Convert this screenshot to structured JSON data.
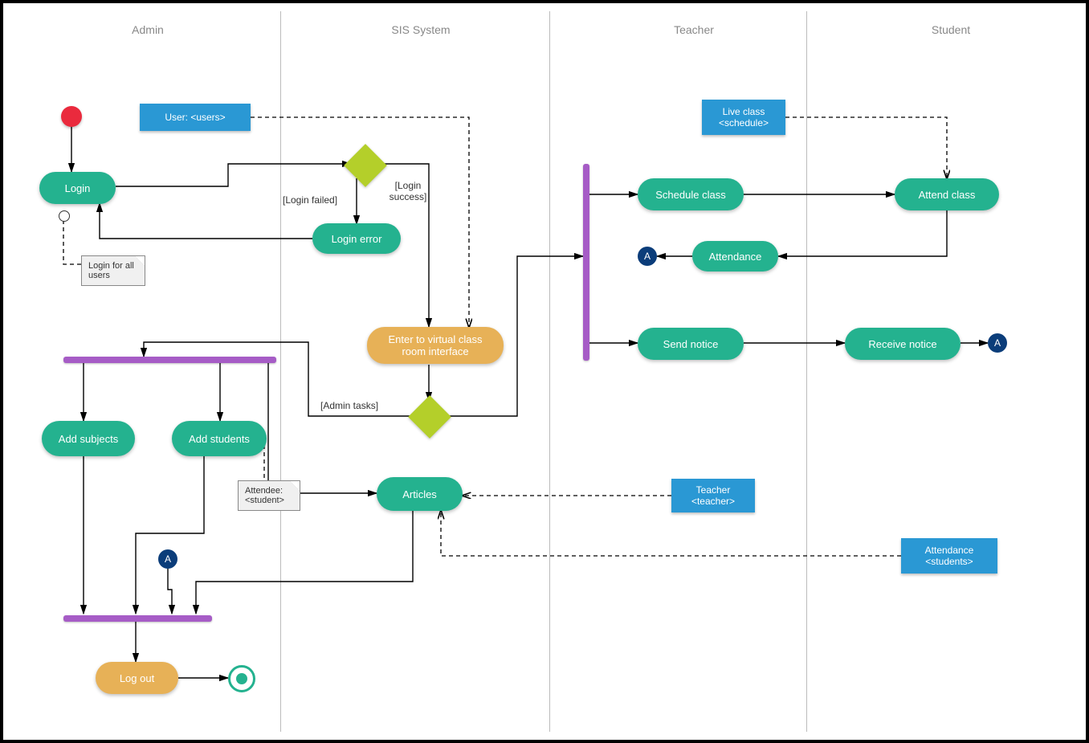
{
  "lanes": {
    "admin": "Admin",
    "sis": "SIS System",
    "teacher": "Teacher",
    "student": "Student"
  },
  "activities": {
    "login": "Login",
    "login_error": "Login error",
    "enter_vc": "Enter to virtual class room interface",
    "add_subjects": "Add subjects",
    "add_students": "Add students",
    "articles": "Articles",
    "log_out": "Log out",
    "schedule_class": "Schedule class",
    "attend_class": "Attend class",
    "attendance": "Attendance",
    "send_notice": "Send notice",
    "receive_notice": "Receive notice"
  },
  "objects": {
    "user": "User: <users>",
    "live_class": "Live class\n<schedule>",
    "teacher": "Teacher\n<teacher>",
    "attendance_students": "Attendance\n<students>"
  },
  "notes": {
    "login_all": "Login for all users",
    "attendee": "Attendee: <student>"
  },
  "guards": {
    "login_failed": "[Login failed]",
    "login_success": "[Login success]",
    "admin_tasks": "[Admin tasks]"
  },
  "connector_label": "A",
  "chart_data": {
    "type": "uml-activity-diagram",
    "swimlanes": [
      "Admin",
      "SIS System",
      "Teacher",
      "Student"
    ],
    "nodes": [
      {
        "id": "start",
        "type": "initial",
        "lane": "Admin"
      },
      {
        "id": "login",
        "type": "activity",
        "lane": "Admin",
        "label": "Login"
      },
      {
        "id": "d1",
        "type": "decision",
        "lane": "SIS System"
      },
      {
        "id": "login_error",
        "type": "activity",
        "lane": "SIS System",
        "label": "Login error"
      },
      {
        "id": "enter_vc",
        "type": "activity",
        "lane": "SIS System",
        "label": "Enter to virtual class room interface"
      },
      {
        "id": "d2",
        "type": "decision",
        "lane": "SIS System"
      },
      {
        "id": "fork_admin",
        "type": "fork",
        "lane": "Admin",
        "orientation": "horizontal"
      },
      {
        "id": "add_subjects",
        "type": "activity",
        "lane": "Admin",
        "label": "Add subjects"
      },
      {
        "id": "add_students",
        "type": "activity",
        "lane": "Admin",
        "label": "Add students"
      },
      {
        "id": "articles",
        "type": "activity",
        "lane": "SIS System",
        "label": "Articles"
      },
      {
        "id": "join_admin",
        "type": "join",
        "lane": "Admin",
        "orientation": "horizontal"
      },
      {
        "id": "log_out",
        "type": "activity",
        "lane": "Admin",
        "label": "Log out"
      },
      {
        "id": "end",
        "type": "final",
        "lane": "Admin"
      },
      {
        "id": "connA_in",
        "type": "connector",
        "label": "A",
        "lane": "Admin"
      },
      {
        "id": "fork_ts",
        "type": "fork",
        "lane": "Teacher",
        "orientation": "vertical"
      },
      {
        "id": "schedule_class",
        "type": "activity",
        "lane": "Teacher",
        "label": "Schedule class"
      },
      {
        "id": "attend_class",
        "type": "activity",
        "lane": "Student",
        "label": "Attend class"
      },
      {
        "id": "attendance",
        "type": "activity",
        "lane": "Teacher",
        "label": "Attendance"
      },
      {
        "id": "connA_out1",
        "type": "connector",
        "label": "A",
        "lane": "Teacher"
      },
      {
        "id": "send_notice",
        "type": "activity",
        "lane": "Teacher",
        "label": "Send notice"
      },
      {
        "id": "receive_notice",
        "type": "activity",
        "lane": "Student",
        "label": "Receive notice"
      },
      {
        "id": "connA_out2",
        "type": "connector",
        "label": "A",
        "lane": "Student"
      },
      {
        "id": "obj_user",
        "type": "object",
        "lane": "Admin",
        "label": "User: <users>"
      },
      {
        "id": "obj_live",
        "type": "object",
        "lane": "Teacher",
        "label": "Live class <schedule>"
      },
      {
        "id": "obj_teacher",
        "type": "object",
        "lane": "Teacher",
        "label": "Teacher <teacher>"
      },
      {
        "id": "obj_att_students",
        "type": "object",
        "lane": "Student",
        "label": "Attendance <students>"
      },
      {
        "id": "note_login",
        "type": "note",
        "lane": "Admin",
        "label": "Login for all users"
      },
      {
        "id": "note_attendee",
        "type": "note",
        "lane": "Admin",
        "label": "Attendee: <student>"
      }
    ],
    "edges": [
      {
        "from": "start",
        "to": "login"
      },
      {
        "from": "login",
        "to": "d1"
      },
      {
        "from": "d1",
        "to": "login_error",
        "guard": "[Login failed]"
      },
      {
        "from": "login_error",
        "to": "login"
      },
      {
        "from": "d1",
        "to": "enter_vc",
        "guard": "[Login success]"
      },
      {
        "from": "enter_vc",
        "to": "d2"
      },
      {
        "from": "d2",
        "to": "fork_admin",
        "guard": "[Admin tasks]"
      },
      {
        "from": "d2",
        "to": "fork_ts"
      },
      {
        "from": "fork_admin",
        "to": "add_subjects"
      },
      {
        "from": "fork_admin",
        "to": "add_students"
      },
      {
        "from": "fork_admin",
        "to": "articles"
      },
      {
        "from": "add_subjects",
        "to": "join_admin"
      },
      {
        "from": "add_students",
        "to": "join_admin"
      },
      {
        "from": "articles",
        "to": "join_admin"
      },
      {
        "from": "connA_in",
        "to": "join_admin"
      },
      {
        "from": "join_admin",
        "to": "log_out"
      },
      {
        "from": "log_out",
        "to": "end"
      },
      {
        "from": "fork_ts",
        "to": "schedule_class"
      },
      {
        "from": "schedule_class",
        "to": "attend_class"
      },
      {
        "from": "attend_class",
        "to": "attendance"
      },
      {
        "from": "attendance",
        "to": "connA_out1"
      },
      {
        "from": "fork_ts",
        "to": "send_notice"
      },
      {
        "from": "send_notice",
        "to": "receive_notice"
      },
      {
        "from": "receive_notice",
        "to": "connA_out2"
      },
      {
        "from": "obj_user",
        "to": "enter_vc",
        "style": "dashed"
      },
      {
        "from": "obj_live",
        "to": "attend_class",
        "style": "dashed"
      },
      {
        "from": "obj_teacher",
        "to": "articles",
        "style": "dashed"
      },
      {
        "from": "obj_att_students",
        "to": "articles",
        "style": "dashed"
      },
      {
        "from": "note_login",
        "to": "login",
        "style": "dashed"
      },
      {
        "from": "note_attendee",
        "to": "add_students",
        "style": "dashed"
      }
    ]
  }
}
